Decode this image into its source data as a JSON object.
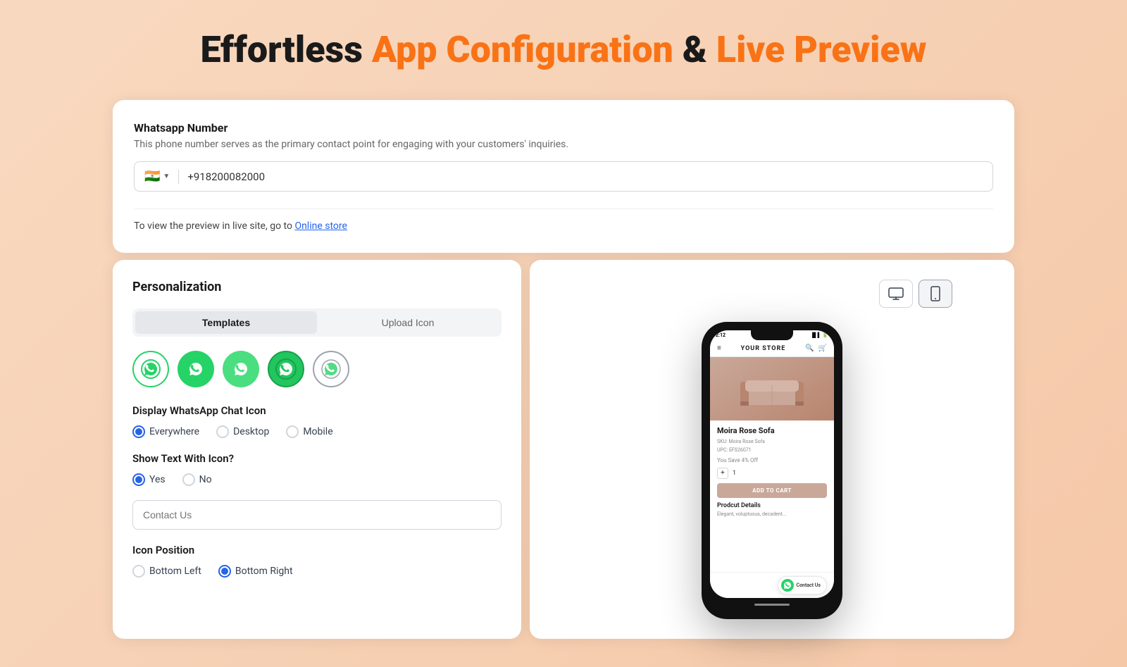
{
  "page": {
    "title_part1": "Effortless",
    "title_part2": "App Configuration",
    "title_part3": "&",
    "title_part4": "Live Preview"
  },
  "whatsapp_section": {
    "title": "Whatsapp Number",
    "description": "This phone number serves as the primary contact point for engaging with your customers' inquiries.",
    "flag_emoji": "🇮🇳",
    "phone_number": "+918200082000",
    "preview_note_text": "To view the preview in live site, go to",
    "preview_link_text": "Online store"
  },
  "personalization": {
    "title": "Personalization",
    "tab_templates": "Templates",
    "tab_upload": "Upload Icon",
    "display_icon_label": "Display WhatsApp Chat Icon",
    "display_options": [
      {
        "label": "Everywhere",
        "selected": true
      },
      {
        "label": "Desktop",
        "selected": false
      },
      {
        "label": "Mobile",
        "selected": false
      }
    ],
    "show_text_label": "Show Text With Icon?",
    "show_text_options": [
      {
        "label": "Yes",
        "selected": true
      },
      {
        "label": "No",
        "selected": false
      }
    ],
    "contact_input_placeholder": "Contact Us",
    "contact_input_value": "",
    "icon_position_label": "Icon Position",
    "position_options": [
      {
        "label": "Bottom Left",
        "selected": false
      },
      {
        "label": "Bottom Right",
        "selected": true
      }
    ]
  },
  "preview": {
    "store_name": "YOUR STORE",
    "product_name": "Moira Rose Sofa",
    "sku_label": "SKU: Moira Rose Sofa",
    "upc_label": "UPC: EFS26071",
    "price_placeholder": "You Save 4% Off",
    "qty_minus": "-",
    "qty_value": "1",
    "qty_plus": "+",
    "add_to_cart": "ADD TO CART",
    "product_details_label": "Prodcut Details",
    "product_desc": "Elegant, voluptuous, decadent...",
    "contact_us_label": "Contact Us"
  },
  "icons": {
    "desktop": "🖥",
    "mobile": "📱",
    "menu": "≡",
    "search": "🔍",
    "cart": "🛒",
    "whatsapp": "💬"
  }
}
